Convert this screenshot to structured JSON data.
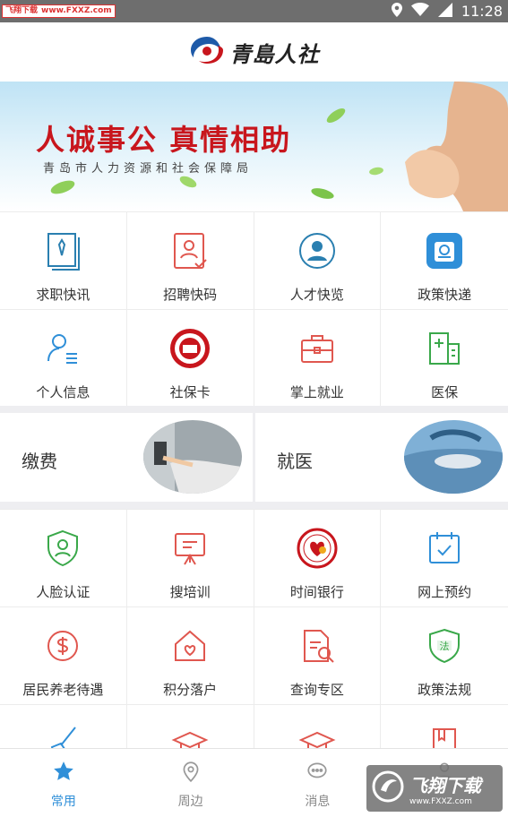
{
  "status_bar": {
    "watermark_site": "飞翔下载",
    "watermark_url": "www.FXXZ.com",
    "time": "11:28",
    "icons": [
      "location-icon",
      "wifi-icon",
      "signal-icon"
    ]
  },
  "header": {
    "app_name": "青島人社"
  },
  "banner": {
    "title": "人诚事公  真情相助",
    "subtitle": "青岛市人力资源和社会保障局"
  },
  "grid_top": [
    {
      "label": "求职快讯",
      "icon": "document-tie-icon",
      "color": "#2a7fb0"
    },
    {
      "label": "招聘快码",
      "icon": "resume-icon",
      "color": "#e0574f"
    },
    {
      "label": "人才快览",
      "icon": "person-circle-icon",
      "color": "#2a7fb0"
    },
    {
      "label": "政策快递",
      "icon": "policy-icon",
      "color": "#2f8fd8"
    },
    {
      "label": "个人信息",
      "icon": "user-info-icon",
      "color": "#2f8fd8"
    },
    {
      "label": "社保卡",
      "icon": "social-security-badge-icon",
      "color": "#c8161d"
    },
    {
      "label": "掌上就业",
      "icon": "briefcase-icon",
      "color": "#e0574f"
    },
    {
      "label": "医保",
      "icon": "hospital-icon",
      "color": "#3aa84a"
    }
  ],
  "features": [
    {
      "label": "缴费"
    },
    {
      "label": "就医"
    }
  ],
  "grid_bottom": [
    {
      "label": "人脸认证",
      "icon": "face-shield-icon",
      "color": "#3aa84a"
    },
    {
      "label": "搜培训",
      "icon": "training-board-icon",
      "color": "#e0574f"
    },
    {
      "label": "时间银行",
      "icon": "time-bank-badge-icon",
      "color": "#c8161d"
    },
    {
      "label": "网上预约",
      "icon": "calendar-check-icon",
      "color": "#2f8fd8"
    },
    {
      "label": "居民养老待遇",
      "icon": "money-circle-icon",
      "color": "#e0574f"
    },
    {
      "label": "积分落户",
      "icon": "house-heart-icon",
      "color": "#e0574f"
    },
    {
      "label": "查询专区",
      "icon": "search-document-icon",
      "color": "#e0574f"
    },
    {
      "label": "政策法规",
      "icon": "law-shield-icon",
      "color": "#3aa84a"
    },
    {
      "label": "",
      "icon": "broom-icon",
      "color": "#2f8fd8"
    },
    {
      "label": "",
      "icon": "graduation-cap-icon",
      "color": "#e0574f"
    },
    {
      "label": "",
      "icon": "graduation-cap-icon",
      "color": "#e0574f"
    },
    {
      "label": "",
      "icon": "book-icon",
      "color": "#e0574f"
    }
  ],
  "bottom_nav": [
    {
      "label": "常用",
      "icon": "star-icon",
      "active": true
    },
    {
      "label": "周边",
      "icon": "map-pin-icon",
      "active": false
    },
    {
      "label": "消息",
      "icon": "chat-bubble-icon",
      "active": false
    },
    {
      "label": "",
      "icon": "user-icon",
      "active": false
    }
  ],
  "bottom_watermark": {
    "title": "飞翔下载",
    "url": "www.FXXZ.com"
  }
}
